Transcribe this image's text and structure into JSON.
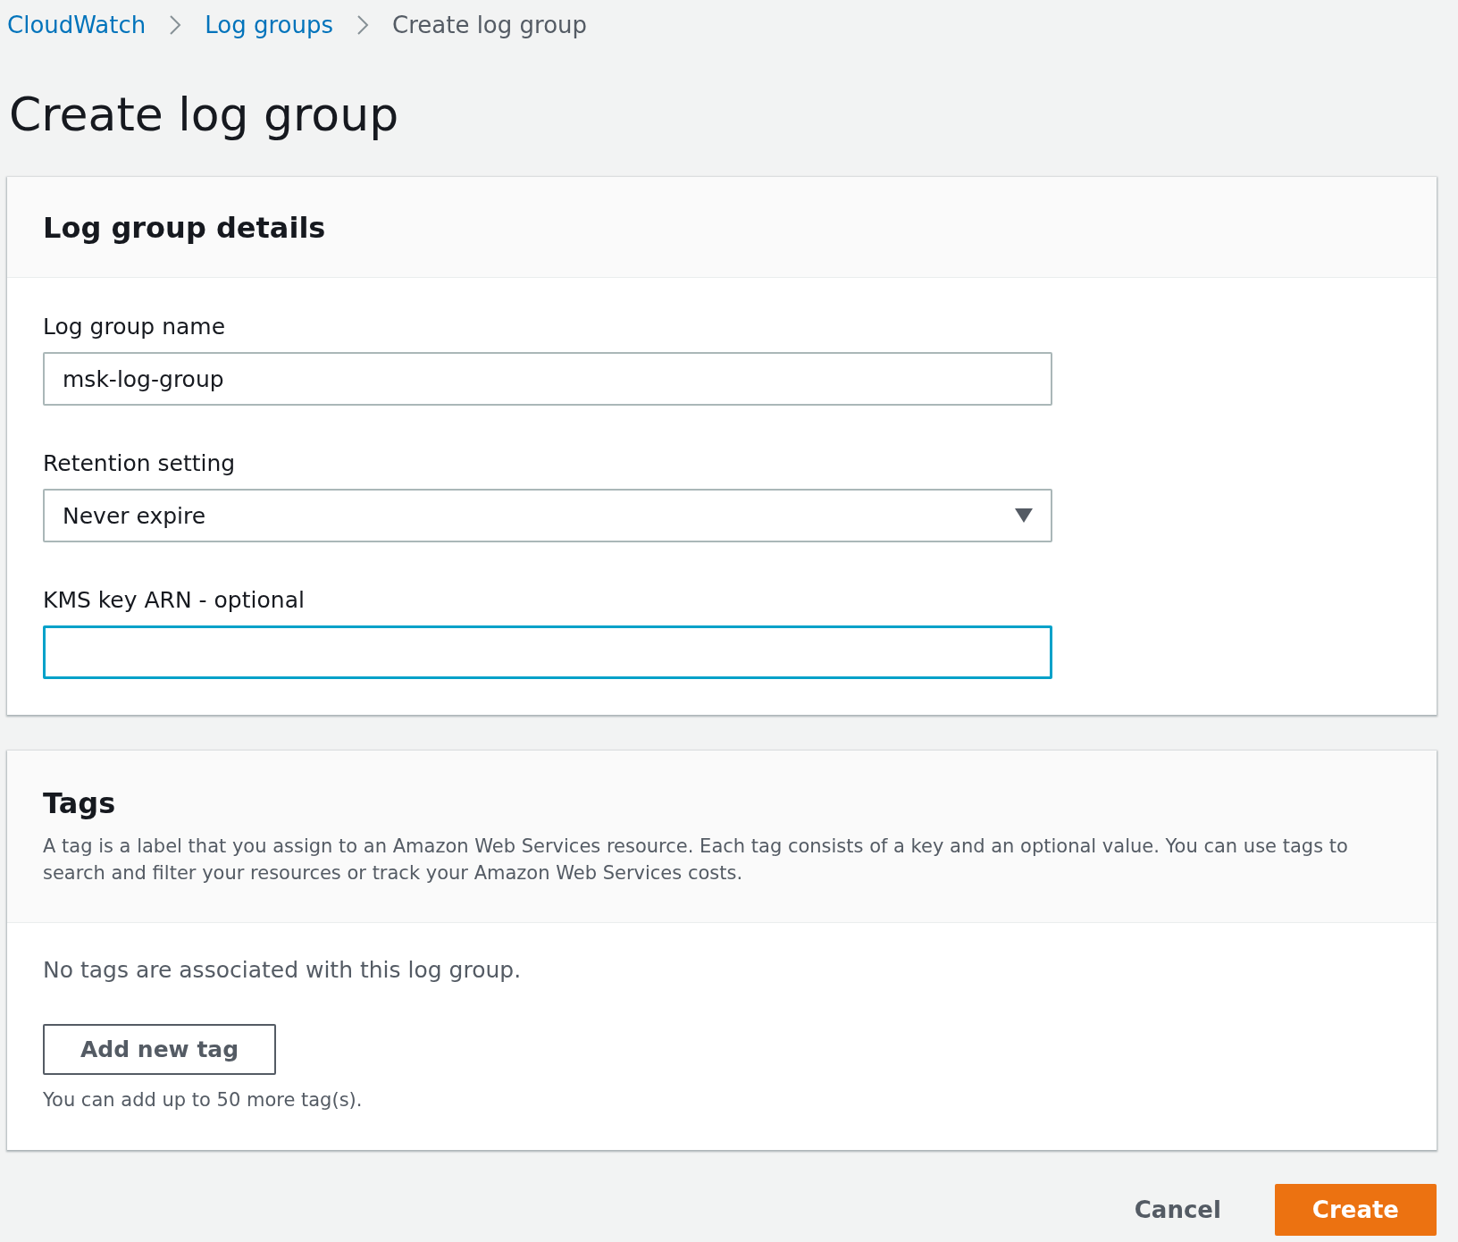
{
  "breadcrumb": [
    {
      "label": "CloudWatch",
      "kind": "link"
    },
    {
      "label": "Log groups",
      "kind": "link"
    },
    {
      "label": "Create log group",
      "kind": "current"
    }
  ],
  "title": "Create log group",
  "details": {
    "heading": "Log group details",
    "fields": [
      {
        "kind": "text",
        "label": "Log group name",
        "value": "msk-log-group",
        "focused": false
      },
      {
        "kind": "select",
        "label": "Retention setting",
        "value": "Never expire",
        "focused": false
      },
      {
        "kind": "text",
        "label": "KMS key ARN - optional",
        "focused": true
      }
    ]
  },
  "tags": {
    "heading": "Tags",
    "description": "A tag is a label that you assign to an Amazon Web Services resource. Each tag consists of a key and an optional value. You can use tags to search and filter your resources or track your Amazon Web Services costs.",
    "empty_text": "No tags are associated with this log group.",
    "add_button": "Add new tag",
    "hint": "You can add up to 50 more tag(s)."
  },
  "actions": {
    "cancel": "Cancel",
    "create": "Create"
  }
}
